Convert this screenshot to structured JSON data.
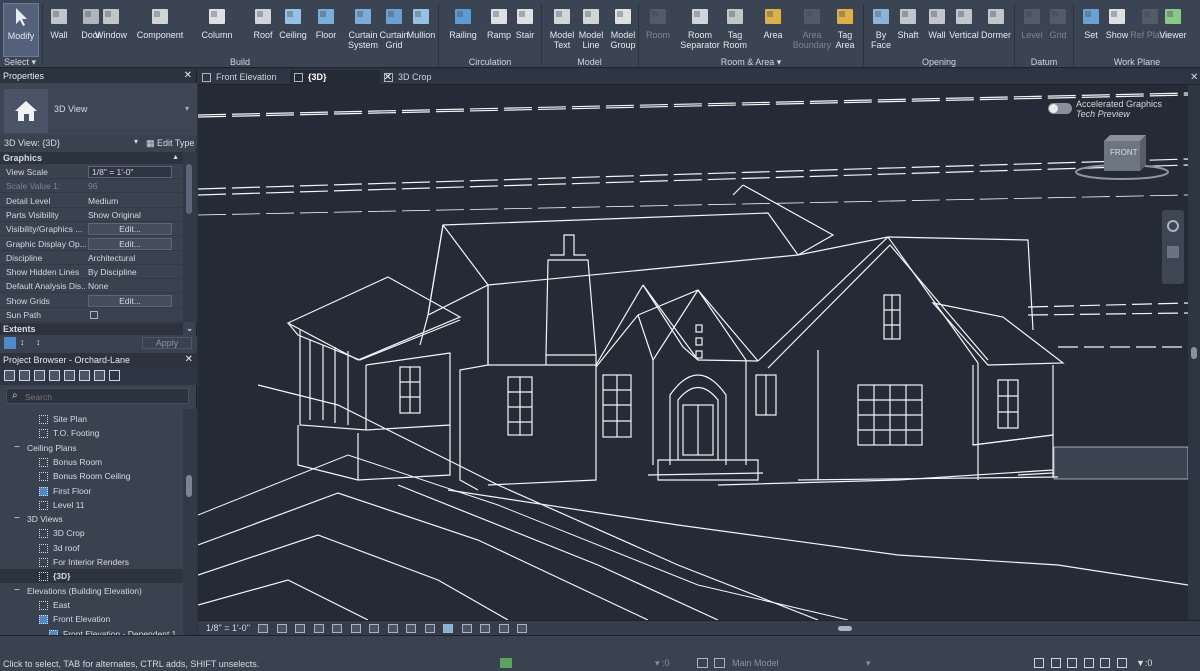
{
  "ribbon": {
    "select": {
      "modify": "Modify",
      "select": "Select ▾"
    },
    "build": {
      "title": "Build",
      "items": [
        "Wall",
        "Door",
        "Window",
        "Component",
        "Column",
        "Roof",
        "Ceiling",
        "Floor",
        "Curtain System",
        "Curtain Grid",
        "Mullion"
      ]
    },
    "circulation": {
      "title": "Circulation",
      "items": [
        "Railing",
        "Ramp",
        "Stair"
      ]
    },
    "model": {
      "title": "Model",
      "items": [
        "Model Text",
        "Model Line",
        "Model Group"
      ]
    },
    "room_area": {
      "title": "Room & Area ▾",
      "items": [
        "Room",
        "Room Separator",
        "Tag Room",
        "Area",
        "Area Boundary",
        "Tag Area"
      ]
    },
    "opening": {
      "title": "Opening",
      "items": [
        "By Face",
        "Shaft",
        "Wall",
        "Vertical",
        "Dormer"
      ]
    },
    "datum": {
      "title": "Datum",
      "items": [
        "Level",
        "Grid"
      ]
    },
    "work_plane": {
      "title": "Work Plane",
      "items": [
        "Set",
        "Show",
        "Ref Plane",
        "Viewer"
      ]
    }
  },
  "properties": {
    "title": "Properties",
    "type_name": "3D View",
    "instance": "3D View: {3D}",
    "edit_type": "Edit Type",
    "group_graphics": "Graphics",
    "rows": [
      {
        "k": "View Scale",
        "v": "1/8\" = 1'-0\"",
        "kind": "input"
      },
      {
        "k": "Scale Value    1:",
        "v": "96",
        "kind": "dim"
      },
      {
        "k": "Detail Level",
        "v": "Medium",
        "kind": "text"
      },
      {
        "k": "Parts Visibility",
        "v": "Show Original",
        "kind": "text"
      },
      {
        "k": "Visibility/Graphics ...",
        "v": "Edit...",
        "kind": "btn"
      },
      {
        "k": "Graphic Display Op...",
        "v": "Edit...",
        "kind": "btn"
      },
      {
        "k": "Discipline",
        "v": "Architectural",
        "kind": "text"
      },
      {
        "k": "Show Hidden Lines",
        "v": "By Discipline",
        "kind": "text"
      },
      {
        "k": "Default Analysis Dis...",
        "v": "None",
        "kind": "text"
      },
      {
        "k": "Show Grids",
        "v": "Edit...",
        "kind": "btn"
      },
      {
        "k": "Sun Path",
        "v": "",
        "kind": "check"
      }
    ],
    "group_extents": "Extents",
    "apply": "Apply"
  },
  "browser": {
    "title": "Project Browser - Orchard-Lane",
    "search_placeholder": "Search",
    "items": [
      {
        "t": "Site Plan",
        "lvl": 2,
        "icon": true
      },
      {
        "t": "T.O. Footing",
        "lvl": 2,
        "icon": true
      },
      {
        "t": "Ceiling Plans",
        "lvl": 1,
        "icon": false
      },
      {
        "t": "Bonus Room",
        "lvl": 2,
        "icon": true
      },
      {
        "t": "Bonus Room Ceiling",
        "lvl": 2,
        "icon": true
      },
      {
        "t": "First Floor",
        "lvl": 2,
        "icon": true
      },
      {
        "t": "Level 11",
        "lvl": 2,
        "icon": true
      },
      {
        "t": "3D Views",
        "lvl": 1,
        "icon": false
      },
      {
        "t": "3D Crop",
        "lvl": 2,
        "icon": true
      },
      {
        "t": "3d roof",
        "lvl": 2,
        "icon": true
      },
      {
        "t": "For Interior Renders",
        "lvl": 2,
        "icon": true
      },
      {
        "t": "{3D}",
        "lvl": 2,
        "icon": true,
        "bold": true
      },
      {
        "t": "Elevations (Building Elevation)",
        "lvl": 1,
        "icon": false
      },
      {
        "t": "East",
        "lvl": 2,
        "icon": true
      },
      {
        "t": "Front Elevation",
        "lvl": 2,
        "icon": true
      },
      {
        "t": "Front Elevation - Dependent 1",
        "lvl": 3,
        "icon": true
      }
    ]
  },
  "tabs": [
    {
      "label": "Front Elevation",
      "active": false
    },
    {
      "label": "{3D}",
      "active": true
    },
    {
      "label": "3D Crop",
      "active": false
    }
  ],
  "viewport": {
    "accel_title": "Accelerated Graphics",
    "accel_sub": "Tech Preview",
    "cube_label": "FRONT"
  },
  "viewbar": {
    "scale": "1/8\" = 1'-0\""
  },
  "status": {
    "hint": "Click to select, TAB for alternates, CTRL adds, SHIFT unselects.",
    "model": "Main Model",
    "count_a": ":0",
    "count_b": ":0"
  },
  "colors": {
    "bg": "#252b36",
    "line": "#f2f4f7",
    "ribbon": "#3b4453"
  }
}
